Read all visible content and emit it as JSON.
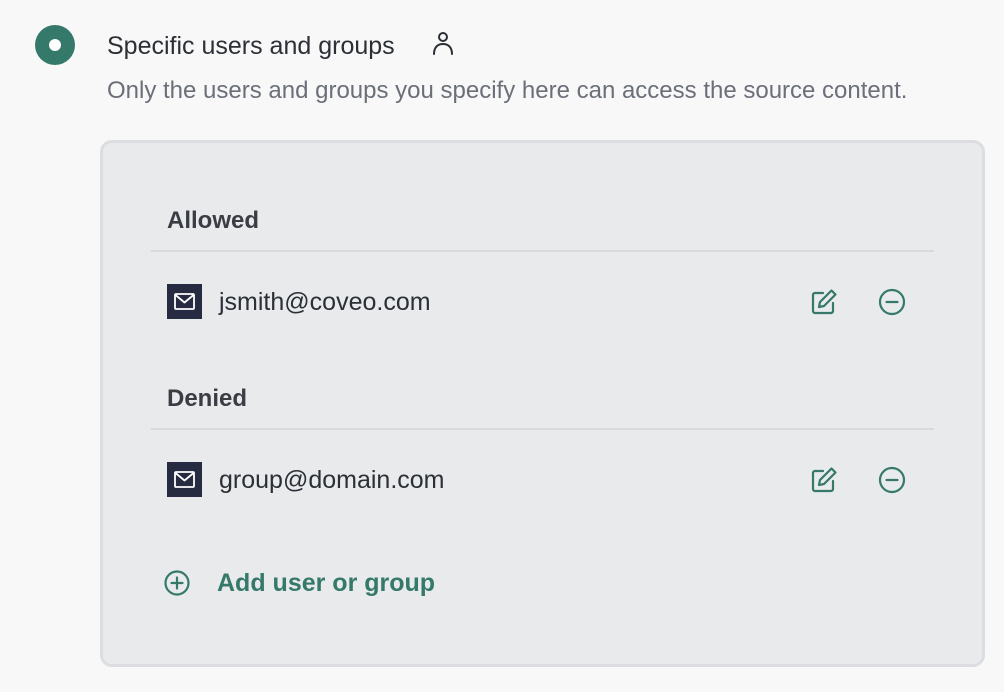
{
  "option": {
    "title": "Specific users and groups",
    "description": "Only the users and groups you specify here can access the source content.",
    "selected": true,
    "title_icon": "user-icon"
  },
  "allowed": {
    "heading": "Allowed",
    "entries": [
      {
        "email": "jsmith@coveo.com",
        "icon": "mail-icon"
      }
    ]
  },
  "denied": {
    "heading": "Denied",
    "entries": [
      {
        "email": "group@domain.com",
        "icon": "mail-icon"
      }
    ]
  },
  "add_button": {
    "label": "Add user or group",
    "icon": "plus-circle-icon"
  },
  "colors": {
    "accent": "#35796a",
    "mail_box": "#262b42",
    "panel_bg": "#e9eaec",
    "page_bg": "#f8f8f9"
  }
}
